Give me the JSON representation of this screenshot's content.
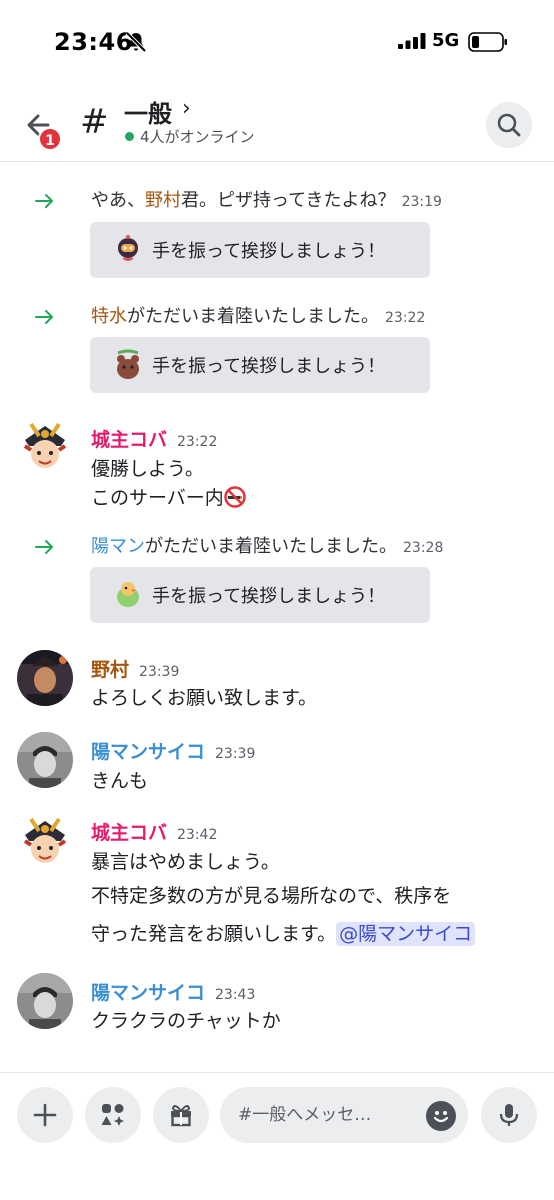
{
  "status_bar": {
    "time": "23:46",
    "network": "5G"
  },
  "header": {
    "badge_count": "1",
    "hash": "#",
    "title": "一般",
    "chevron": "›",
    "online": "4人がオンライン",
    "icons": {
      "back": "back-arrow-icon",
      "search": "search-icon"
    }
  },
  "messages": {
    "sys1": {
      "prefix": "やあ、",
      "name": "野村",
      "suffix": "君。ピザ持ってきたよね？",
      "time": "23:19"
    },
    "wave_label": "手を振って挨拶しましょう！",
    "sys2": {
      "name": "特水",
      "suffix": "がただいま着陸いたしました。",
      "time": "23:22"
    },
    "m1": {
      "author": "城主コバ",
      "time": "23:22",
      "lines": [
        "優勝しよう。",
        "このサーバー内"
      ]
    },
    "sys3": {
      "name": "陽マン",
      "suffix": "がただいま着陸いたしました。",
      "time": "23:28"
    },
    "m2": {
      "author": "野村",
      "time": "23:39",
      "text": "よろしくお願い致します。"
    },
    "m3": {
      "author": "陽マンサイコ",
      "time": "23:39",
      "text": "きんも"
    },
    "m4": {
      "author": "城主コバ",
      "time": "23:42",
      "line1": "暴言はやめましょう。",
      "line2": "不特定多数の方が見る場所なので、秩序を",
      "line3": "守った発言をお願いします。",
      "mention": "@陽マンサイコ"
    },
    "m5": {
      "author": "陽マンサイコ",
      "time": "23:43",
      "text": "クラクラのチャットか"
    }
  },
  "composer": {
    "placeholder": "#一般へメッセ…"
  },
  "colors": {
    "name_orange": "#a5570f",
    "name_blue": "#3a8fd2",
    "name_pink": "#e31b6d",
    "online": "#23a55a",
    "badge": "#e0333b"
  }
}
